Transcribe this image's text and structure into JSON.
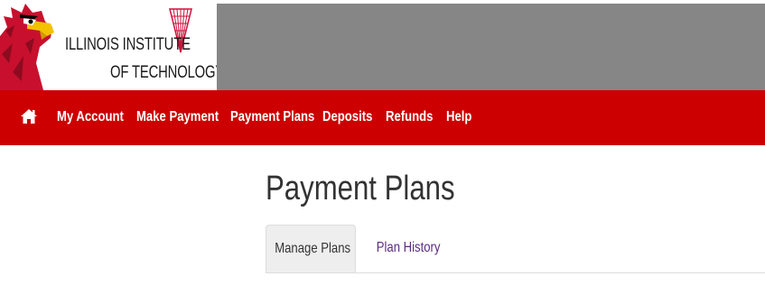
{
  "header": {
    "logo_line1": "ILLINOIS INSTITUTE",
    "logo_line2": "OF TECHNOLOGY",
    "mascot_icon": "scarlet-hawk-mascot-icon",
    "logo_mark_icon": "iit-triangle-logo-icon"
  },
  "nav": {
    "home_icon": "home-icon",
    "items": [
      {
        "label": "My Account"
      },
      {
        "label": "Make Payment"
      },
      {
        "label": "Payment Plans"
      },
      {
        "label": "Deposits"
      },
      {
        "label": "Refunds"
      },
      {
        "label": "Help"
      }
    ]
  },
  "main": {
    "title": "Payment Plans",
    "tabs": [
      {
        "label": "Manage Plans",
        "active": true
      },
      {
        "label": "Plan History",
        "active": false
      }
    ]
  },
  "colors": {
    "nav_background": "#cc0000",
    "banner_grey": "#868686",
    "tab_link": "#5b2b82",
    "active_tab_background": "#eeeeee"
  }
}
